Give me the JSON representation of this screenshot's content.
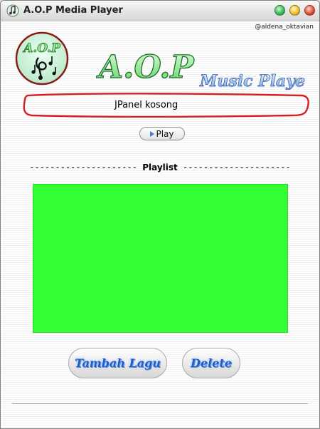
{
  "window": {
    "title": "A.O.P  Media Player",
    "controls": [
      "minimize",
      "maximize",
      "close"
    ]
  },
  "header": {
    "credit": "@aldena_oktavian",
    "logo_text": "A.O.P",
    "banner_title": "A.O.P",
    "banner_subtitle": "Music Player"
  },
  "panel": {
    "text": "JPanel kosong"
  },
  "player": {
    "play_label": "Play"
  },
  "playlist": {
    "dashes_left": "--------------------- ",
    "label": "Playlist",
    "dashes_right": " ---------------------",
    "area_color": "#33ff33"
  },
  "actions": {
    "add_label": "Tambah Lagu",
    "delete_label": "Delete"
  },
  "colors": {
    "accent_green": "#33ff33",
    "button_text": "#1c5ecf",
    "panel_outline": "#d42020"
  }
}
